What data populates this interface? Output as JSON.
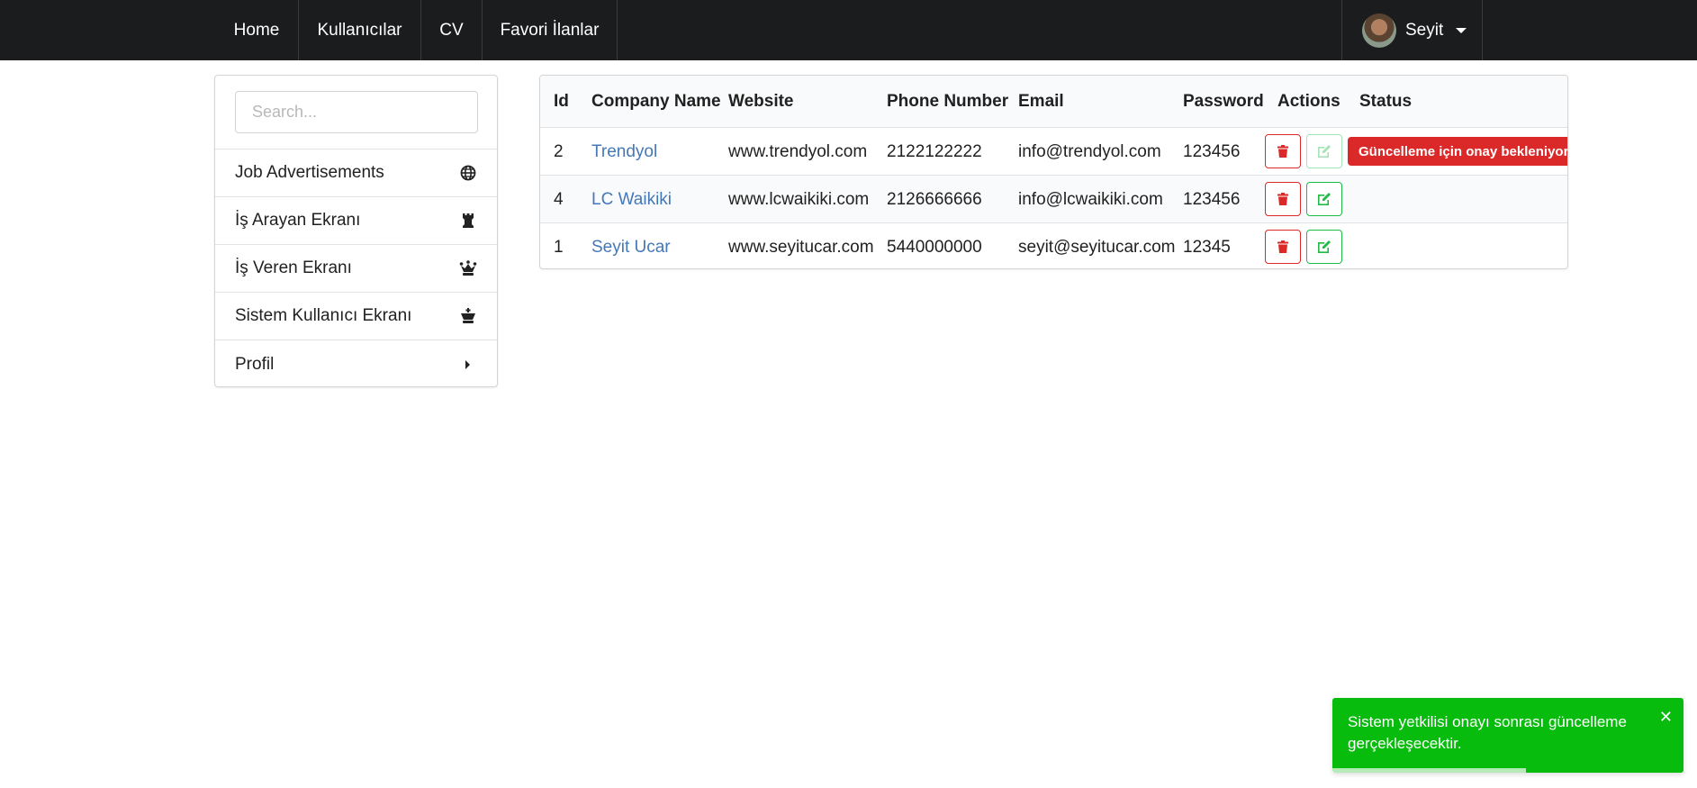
{
  "nav": {
    "items": [
      {
        "label": "Home"
      },
      {
        "label": "Kullanıcılar"
      },
      {
        "label": "CV"
      },
      {
        "label": "Favori İlanlar"
      }
    ],
    "user": {
      "name": "Seyit"
    }
  },
  "sidebar": {
    "search_placeholder": "Search...",
    "items": [
      {
        "label": "Job Advertisements",
        "icon": "globe-icon"
      },
      {
        "label": "İş Arayan Ekranı",
        "icon": "chess-rook-icon"
      },
      {
        "label": "İş Veren Ekranı",
        "icon": "chess-queen-icon"
      },
      {
        "label": "Sistem Kullanıcı Ekranı",
        "icon": "chess-king-icon"
      },
      {
        "label": "Profil",
        "icon": "caret-right-icon"
      }
    ]
  },
  "table": {
    "headers": {
      "id": "Id",
      "company": "Company Name",
      "website": "Website",
      "phone": "Phone Number",
      "email": "Email",
      "password": "Password",
      "actions": "Actions",
      "status": "Status"
    },
    "rows": [
      {
        "id": "2",
        "company": "Trendyol",
        "website": "www.trendyol.com",
        "phone": "2122122222",
        "email": "info@trendyol.com",
        "password": "123456",
        "status": "Güncelleme için onay bekleniyor"
      },
      {
        "id": "4",
        "company": "LC Waikiki",
        "website": "www.lcwaikiki.com",
        "phone": "2126666666",
        "email": "info@lcwaikiki.com",
        "password": "123456",
        "status": ""
      },
      {
        "id": "1",
        "company": "Seyit Ucar",
        "website": "www.seyitucar.com",
        "phone": "5440000000",
        "email": "seyit@seyitucar.com",
        "password": "12345",
        "status": ""
      }
    ]
  },
  "toast": {
    "message": "Sistem yetkilisi onayı sonrası güncelleme gerçekleşecektir.",
    "close": "✕",
    "progress": 0.55
  },
  "colors": {
    "navbar": "#1b1c1d",
    "link": "#4478b8",
    "danger": "#db2828",
    "success": "#21ba45",
    "toast": "#07bc0c"
  }
}
